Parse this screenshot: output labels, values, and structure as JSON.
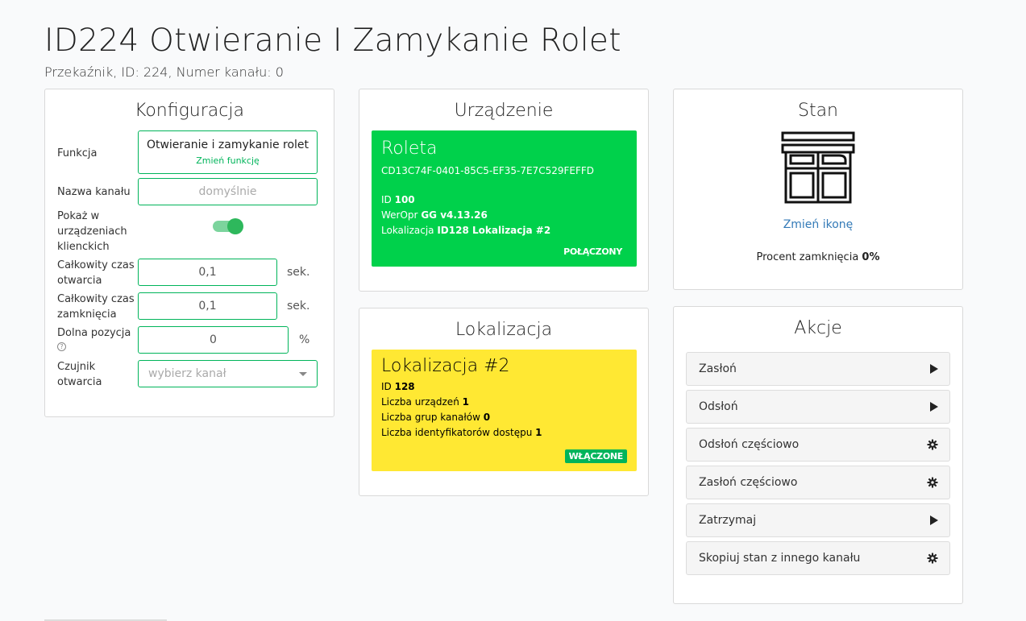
{
  "header": {
    "title": "ID224 Otwieranie I Zamykanie Rolet",
    "subtitle": "Przekaźnik, ID: 224, Numer kanału: 0"
  },
  "config": {
    "title": "Konfiguracja",
    "function_label": "Funkcja",
    "function_value": "Otwieranie i zamykanie rolet",
    "function_change": "Zmień funkcję",
    "channel_name_label": "Nazwa kanału",
    "channel_name_placeholder": "domyślnie",
    "show_label_1": "Pokaż w",
    "show_label_2": "urządzeniach",
    "show_label_3": "klienckich",
    "open_time_label_1": "Całkowity czas",
    "open_time_label_2": "otwarcia",
    "open_time_value": "0,1",
    "open_time_unit": "sek.",
    "close_time_label_1": "Całkowity czas",
    "close_time_label_2": "zamknięcia",
    "close_time_value": "0,1",
    "close_time_unit": "sek.",
    "bottom_label": "Dolna pozycja",
    "bottom_value": "0",
    "bottom_unit": "%",
    "help_glyph": "?",
    "sensor_label_1": "Czujnik",
    "sensor_label_2": "otwarcia",
    "sensor_placeholder": "wybierz kanał"
  },
  "device": {
    "title": "Urządzenie",
    "name": "Roleta",
    "guid": "CD13C74F-0401-85C5-EF35-7E7C529FEFFD",
    "id_label": "ID",
    "id_value": "100",
    "firmware_label": "WerOpr",
    "firmware_value": "GG v4.13.26",
    "location_label": "Lokalizacja",
    "location_value": "ID128 Lokalizacja #2",
    "status": "POŁĄCZONY",
    "color": "#00d14b"
  },
  "location": {
    "title": "Lokalizacja",
    "name": "Lokalizacja #2",
    "id_label": "ID",
    "id_value": "128",
    "devices_label": "Liczba urządzeń",
    "devices_value": "1",
    "groups_label": "Liczba grup kanałów",
    "groups_value": "0",
    "access_label": "Liczba identyfikatorów dostępu",
    "access_value": "1",
    "badge": "WŁĄCZONE",
    "color": "#ffe833"
  },
  "state": {
    "title": "Stan",
    "icon": "roller-shutter-icon",
    "change_icon": "Zmień ikonę",
    "percent_label": "Procent zamknięcia",
    "percent_value": "0%"
  },
  "actions": {
    "title": "Akcje",
    "items": [
      {
        "label": "Zasłoń",
        "icon": "play-icon"
      },
      {
        "label": "Odsłoń",
        "icon": "play-icon"
      },
      {
        "label": "Odsłoń częściowo",
        "icon": "gear-icon"
      },
      {
        "label": "Zasłoń częściowo",
        "icon": "gear-icon"
      },
      {
        "label": "Zatrzymaj",
        "icon": "play-icon"
      },
      {
        "label": "Skopiuj stan z innego kanału",
        "icon": "gear-icon"
      }
    ]
  }
}
